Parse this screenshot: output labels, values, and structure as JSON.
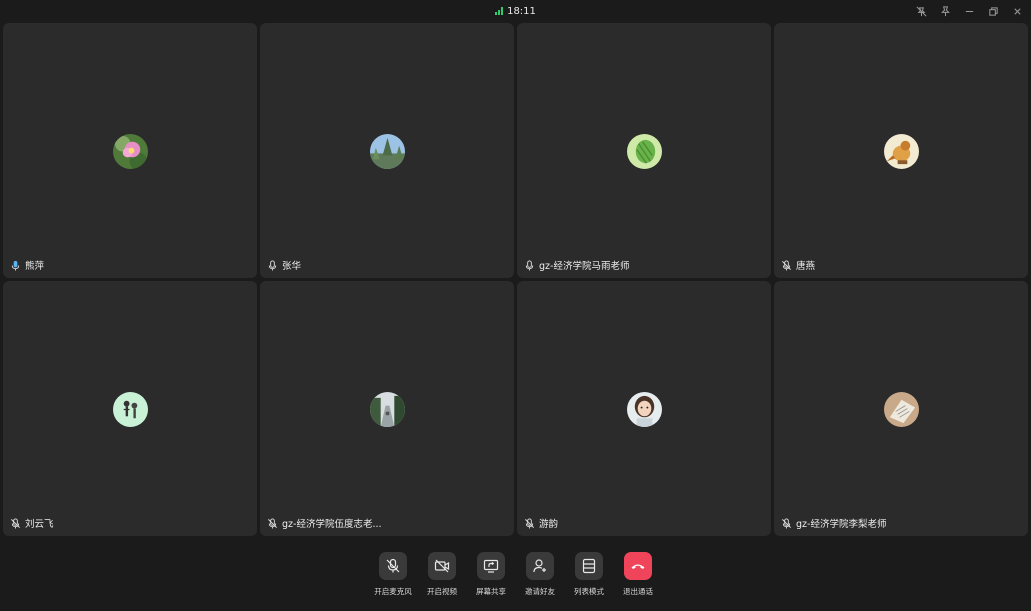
{
  "status": {
    "time": "18:11",
    "signal_color": "#2ecc71"
  },
  "window_controls": [
    "unpin-icon",
    "pin-icon",
    "minimize-icon",
    "restore-icon",
    "close-icon"
  ],
  "participants": [
    {
      "name": "熊萍",
      "mic": "active",
      "avatar": "pink-flower-avatar"
    },
    {
      "name": "张华",
      "mic": "on",
      "avatar": "sky-tree-avatar"
    },
    {
      "name": "gz-经济学院马雨老师",
      "mic": "on",
      "avatar": "green-plant-avatar"
    },
    {
      "name": "唐燕",
      "mic": "muted",
      "avatar": "bird-avatar"
    },
    {
      "name": "刘云飞",
      "mic": "muted",
      "avatar": "cartoon-figures-avatar"
    },
    {
      "name": "gz-经济学院伍度志老...",
      "mic": "muted",
      "avatar": "street-photo-avatar"
    },
    {
      "name": "游韵",
      "mic": "muted",
      "avatar": "girl-photo-avatar"
    },
    {
      "name": "gz-经济学院李梨老师",
      "mic": "muted",
      "avatar": "book-photo-avatar"
    }
  ],
  "toolbar": {
    "mic_label": "开启麦克风",
    "video_label": "开启视频",
    "share_label": "屏幕共享",
    "invite_label": "邀请好友",
    "layout_label": "列表模式",
    "leave_label": "退出通话",
    "leave_color": "#f0445b"
  }
}
